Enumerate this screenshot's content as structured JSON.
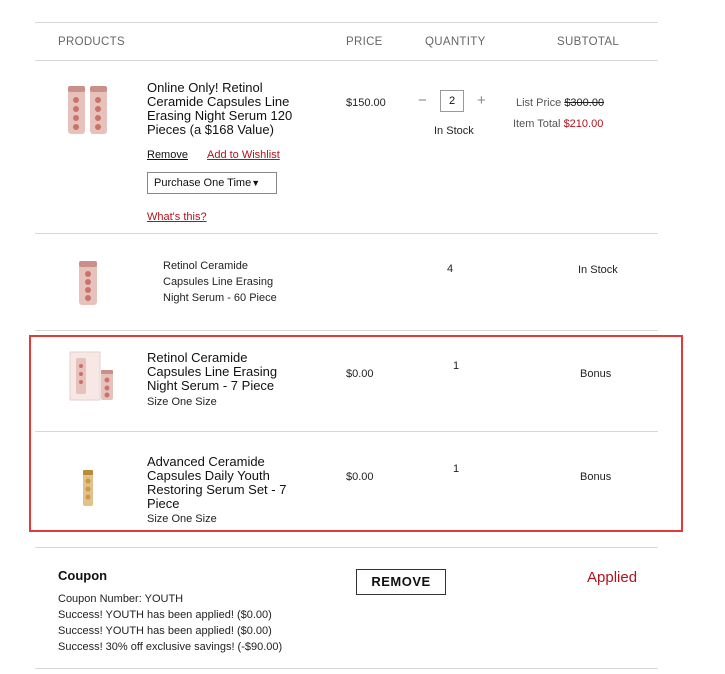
{
  "columns": {
    "products": "PRODUCTS",
    "price": "PRICE",
    "quantity": "QUANTITY",
    "subtotal": "SUBTOTAL"
  },
  "items": [
    {
      "name_lines": [
        "Online Only! Retinol",
        "Ceramide Capsules Line",
        "Erasing Night Serum 120",
        "Pieces (a $168 Value)"
      ],
      "price": "$150.00",
      "quantity": "2",
      "stock": "In Stock",
      "list_price_label": "List Price",
      "list_price": "$300.00",
      "item_total_label": "Item Total",
      "item_total": "$210.00",
      "remove_label": "Remove",
      "wishlist_label": "Add to Wishlist",
      "purchase_option": "Purchase One Time",
      "whats_this": "What's this?"
    },
    {
      "name_lines": [
        "Retinol Ceramide",
        "Capsules Line Erasing",
        "Night Serum - 60 Piece"
      ],
      "quantity": "4",
      "status": "In Stock"
    },
    {
      "name_lines": [
        "Retinol Ceramide",
        "Capsules Line Erasing",
        "Night Serum - 7 Piece"
      ],
      "size": "Size One Size",
      "price": "$0.00",
      "quantity": "1",
      "status": "Bonus"
    },
    {
      "name_lines": [
        "Advanced Ceramide",
        "Capsules Daily Youth",
        "Restoring Serum Set - 7",
        "Piece"
      ],
      "size": "Size One Size",
      "price": "$0.00",
      "quantity": "1",
      "status": "Bonus"
    }
  ],
  "coupon": {
    "title": "Coupon",
    "number": "Coupon Number: YOUTH",
    "messages": [
      "Success! YOUTH has been applied! ($0.00)",
      "Success! YOUTH has been applied! ($0.00)",
      "Success! 30% off exclusive savings! (-$90.00)"
    ],
    "remove_label": "REMOVE",
    "status": "Applied"
  },
  "colors": {
    "accent_red": "#b1121c",
    "highlight_border": "#e23a3a",
    "product_pink": "#d9a3a0",
    "product_gold": "#c99a4a"
  }
}
